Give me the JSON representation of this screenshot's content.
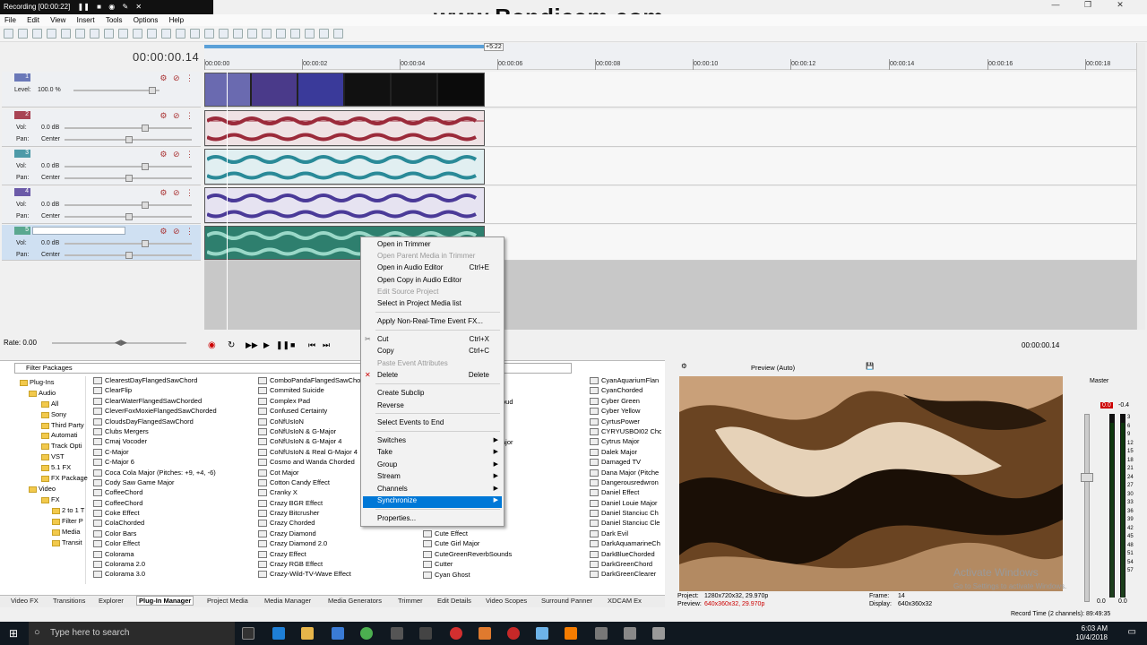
{
  "recorder": {
    "title": "Recording [00:00:22]"
  },
  "watermark": "www.Bandicam.com",
  "menu": [
    "File",
    "Edit",
    "View",
    "Insert",
    "Tools",
    "Options",
    "Help"
  ],
  "timeline": {
    "cursor": "00:00:00.14",
    "region_label": "+5:22",
    "ticks": [
      "00:00:00",
      "00:00:02",
      "00:00:04",
      "00:00:06",
      "00:00:08",
      "00:00:10",
      "00:00:12",
      "00:00:14",
      "00:00:16",
      "00:00:18"
    ]
  },
  "tracks": [
    {
      "num": "1",
      "type": "video",
      "level_label": "Level:",
      "level_value": "100.0 %",
      "color": "#6a78b8"
    },
    {
      "num": "2",
      "type": "audio",
      "vol_label": "Vol:",
      "vol_value": "0.0 dB",
      "pan_label": "Pan:",
      "pan_value": "Center",
      "color": "#a84454",
      "wave": "#9b2a3a"
    },
    {
      "num": "3",
      "type": "audio",
      "vol_label": "Vol:",
      "vol_value": "0.0 dB",
      "pan_label": "Pan:",
      "pan_value": "Center",
      "color": "#4e9aa8",
      "wave": "#2a8a98"
    },
    {
      "num": "4",
      "type": "audio",
      "vol_label": "Vol:",
      "vol_value": "0.0 dB",
      "pan_label": "Pan:",
      "pan_value": "Center",
      "color": "#6b5aa8",
      "wave": "#4a3a98"
    },
    {
      "num": "5",
      "type": "audio",
      "vol_label": "Vol:",
      "vol_value": "0.0 dB",
      "pan_label": "Pan:",
      "pan_value": "Center",
      "color": "#5aa890",
      "wave": "#2e8878"
    }
  ],
  "rate": "Rate: 0.00",
  "transport_time": "00:00:00.14",
  "context_menu": [
    {
      "label": "Open in Trimmer",
      "enabled": true
    },
    {
      "label": "Open Parent Media in Trimmer",
      "enabled": false
    },
    {
      "label": "Open in Audio Editor",
      "shortcut": "Ctrl+E",
      "enabled": true
    },
    {
      "label": "Open Copy in Audio Editor",
      "enabled": true
    },
    {
      "label": "Edit Source Project",
      "enabled": false
    },
    {
      "label": "Select in Project Media list",
      "enabled": true
    },
    {
      "label": "Apply Non-Real-Time Event FX...",
      "enabled": true
    },
    {
      "label": "Cut",
      "shortcut": "Ctrl+X",
      "enabled": true
    },
    {
      "label": "Copy",
      "shortcut": "Ctrl+C",
      "enabled": true
    },
    {
      "label": "Paste Event Attributes",
      "enabled": false
    },
    {
      "label": "Delete",
      "shortcut": "Delete",
      "enabled": true
    },
    {
      "label": "Create Subclip",
      "enabled": true
    },
    {
      "label": "Reverse",
      "enabled": true
    },
    {
      "label": "Select Events to End",
      "enabled": true
    },
    {
      "label": "Switches",
      "submenu": true
    },
    {
      "label": "Take",
      "submenu": true
    },
    {
      "label": "Group",
      "submenu": true
    },
    {
      "label": "Stream",
      "submenu": true
    },
    {
      "label": "Channels",
      "submenu": true
    },
    {
      "label": "Synchronize",
      "submenu": true,
      "highlighted": true
    },
    {
      "label": "Properties...",
      "enabled": true
    }
  ],
  "plugin_manager": {
    "filter_label": "Filter Packages",
    "tree": [
      "Plug-Ins",
      "Audio",
      "All",
      "Sony",
      "Third Party",
      "Automati",
      "Track Opti",
      "VST",
      "5.1 FX",
      "FX Package",
      "Video",
      "FX",
      "2 to 1 T",
      "Filter P",
      "Media",
      "Transit"
    ],
    "col1": [
      "ClearestDayFlangedSawChord",
      "ClearFlip",
      "ClearWaterFlangedSawChorded",
      "CleverFoxMoxieFlangedSawChorded",
      "CloudsDayFlangedSawChord",
      "Clubs Mergers",
      "Cmaj Vocoder",
      "C-Major",
      "C-Major 6",
      "Coca Cola Major (Pitches: +9, +4, -6)",
      "Cody Saw Game Major",
      "CoffeeChord",
      "CoffeeChord",
      "Coke Effect",
      "ColaChorded",
      "Color Bars",
      "Color Effect",
      "Colorama",
      "Colorama 2.0",
      "Colorama 3.0"
    ],
    "col2": [
      "ComboPandaFlangedSawCho",
      "Commited Suicide",
      "Complex Pad",
      "Confused Certainty",
      "CoNfUsIoN",
      "CoNfUsIoN & G-Major",
      "CoNfUsIoN & G-Major 4",
      "CoNfUsIoN & Real G-Major 4",
      "Cosmo and Wanda Chorded",
      "Cot Major",
      "Cotton Candy Effect",
      "Cranky X",
      "Crazy BGR Effect",
      "Crazy Bitcrusher",
      "Crazy Chorded",
      "Crazy Diamond",
      "Crazy Diamond 2.0",
      "Crazy Effect",
      "Crazy RGB Effect",
      "Crazy-Wild-TV-Wave Effect"
    ],
    "col3_partial": [
      "oud",
      "ajor"
    ],
    "col3": [
      "Cute Effect",
      "Cute Girl Major",
      "CuteGreenReverbSounds",
      "Cutter",
      "Cyan Ghost"
    ],
    "col4": [
      "CyanAquariumFlan",
      "CyanChorded",
      "Cyber Green",
      "Cyber Yellow",
      "CyrtusPower",
      "CYRYUSBOI02 Chor",
      "Cytrus Major",
      "Dalek Major",
      "Damaged TV",
      "Dana Major (Pitche",
      "Dangerousredwron",
      "Daniel Effect",
      "Daniel Louie Major",
      "Daniel Stanciuc Ch",
      "Daniel Stanciuc Cle",
      "Dark Evil",
      "DarkAquamarineCh",
      "DarkBlueChorded",
      "DarkGreenChord",
      "DarkGreenClearer"
    ]
  },
  "bottom_tabs": [
    "Video FX",
    "Transitions",
    "Explorer",
    "Plug-In Manager",
    "Project Media",
    "Media Manager",
    "Media Generators",
    "Trimmer",
    "Edit Details",
    "Video Scopes",
    "Surround Panner",
    "XDCAM Ex"
  ],
  "preview": {
    "mode": "Preview (Auto)",
    "project_label": "Project:",
    "project_value": "1280x720x32, 29.970p",
    "preview_label": "Preview:",
    "preview_value": "640x360x32, 29.970p",
    "frame_label": "Frame:",
    "frame_value": "14",
    "display_label": "Display:",
    "display_value": "640x360x32"
  },
  "master": {
    "label": "Master",
    "peak": "0.0",
    "peak2": "-0.4",
    "scale": [
      "3",
      "6",
      "9",
      "12",
      "15",
      "18",
      "21",
      "24",
      "27",
      "30",
      "33",
      "36",
      "39",
      "42",
      "45",
      "48",
      "51",
      "54",
      "57"
    ],
    "bottom_l": "0.0",
    "bottom_r": "0.0"
  },
  "status": "Record Time (2 channels): 89:49:35",
  "activate": {
    "title": "Activate Windows",
    "sub": "Go to Settings to activate Windows."
  },
  "taskbar": {
    "search_placeholder": "Type here to search",
    "time": "6:03 AM",
    "date": "10/4/2018"
  }
}
